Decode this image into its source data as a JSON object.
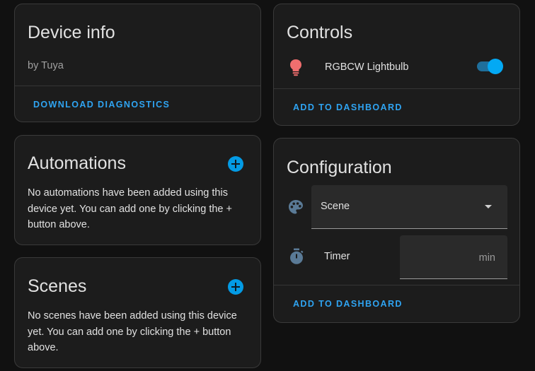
{
  "device_info": {
    "title": "Device info",
    "manufacturer": "by Tuya",
    "download_label": "DOWNLOAD DIAGNOSTICS"
  },
  "automations": {
    "title": "Automations",
    "empty_text": "No automations have been added using this device yet. You can add one by clicking the + button above."
  },
  "scenes": {
    "title": "Scenes",
    "empty_text": "No scenes have been added using this device yet. You can add one by clicking the + button above."
  },
  "controls": {
    "title": "Controls",
    "entity_label": "RGBCW Lightbulb",
    "entity_icon": "lightbulb-icon",
    "entity_icon_color": "#f06e6e",
    "toggle_on": true,
    "add_to_dashboard_label": "ADD TO DASHBOARD"
  },
  "configuration": {
    "title": "Configuration",
    "scene_select_value": "Scene",
    "scene_icon": "palette-icon",
    "timer_label": "Timer",
    "timer_icon": "timer-icon",
    "timer_suffix": "min",
    "add_to_dashboard_label": "ADD TO DASHBOARD"
  },
  "colors": {
    "accent": "#2fa4f2",
    "background": "#111111",
    "card": "#1c1c1c",
    "icon_gray": "#5a7a96"
  }
}
